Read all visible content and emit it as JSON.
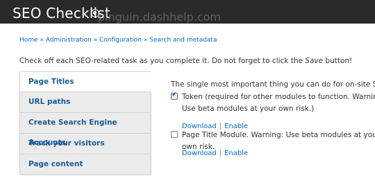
{
  "header": {
    "title": "SEO Checklist",
    "title_icon": "settings-circle-icon",
    "watermark": "pinguin.dashhelp.com"
  },
  "breadcrumb": [
    "Home",
    "Administration",
    "Configuration",
    "Search and metadata"
  ],
  "breadcrumb_separator": "»",
  "intro": {
    "before": "Check off each SEO-related task as you complete it. Do not forget to click the ",
    "emphasis": "Save",
    "after": " button!"
  },
  "tabs": [
    {
      "label": "Page Titles",
      "active": true
    },
    {
      "label": "URL paths",
      "active": false
    },
    {
      "label": "Create Search Engine Accounts",
      "active": false
    },
    {
      "label": "Track your visitors",
      "active": false
    },
    {
      "label": "Page content",
      "active": false
    }
  ],
  "panel": {
    "description": "The single most important thing you can do for on-site SEO.",
    "items": [
      {
        "label": "Token (required for other modules to function. Warning: Use beta modules at your own risk.)",
        "checked": true,
        "download": "Download",
        "enable": "Enable",
        "pipe": "|"
      },
      {
        "label": "Page Title Module. Warning: Use beta modules at your own risk.",
        "checked": false,
        "download": "Download",
        "enable": "Enable",
        "pipe": "|"
      }
    ]
  },
  "colors": {
    "header_bg": "#2a2a2a",
    "link": "#0066cc",
    "tab_text": "#1d5c96",
    "tab_bg": "#ebebeb"
  }
}
